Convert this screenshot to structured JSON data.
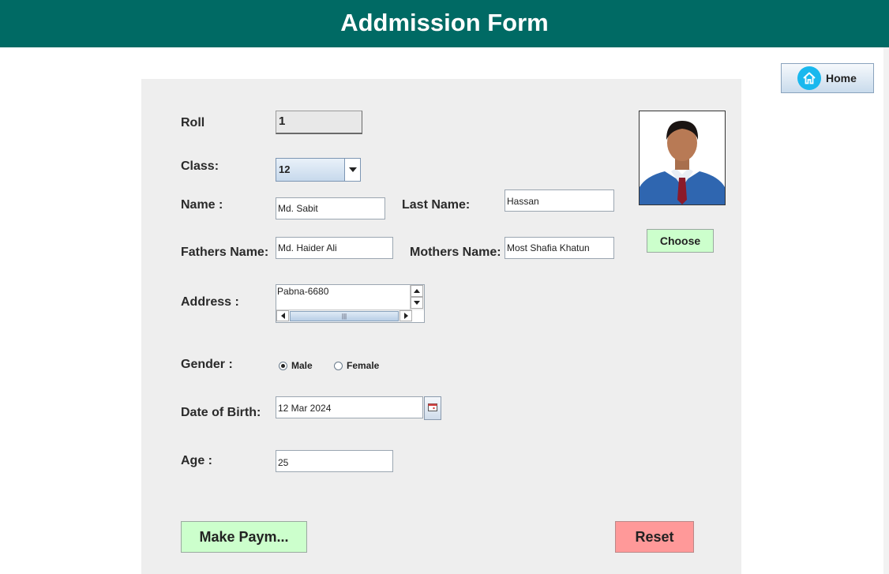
{
  "header": {
    "title": "Addmission Form"
  },
  "home_button": {
    "label": "Home",
    "icon": "home-icon"
  },
  "form": {
    "roll": {
      "label": "Roll",
      "value": "1"
    },
    "class": {
      "label": "Class:",
      "value": "12"
    },
    "name": {
      "label": "Name :",
      "value": "Md. Sabit"
    },
    "last_name": {
      "label": "Last Name:",
      "value": "Hassan"
    },
    "fathers_name": {
      "label": "Fathers Name:",
      "value": "Md. Haider Ali"
    },
    "mothers_name": {
      "label": "Mothers Name:",
      "value": "Most Shafia Khatun"
    },
    "address": {
      "label": "Address :",
      "value": "Pabna-6680"
    },
    "gender": {
      "label": "Gender :",
      "options": [
        "Male",
        "Female"
      ],
      "selected": "Male"
    },
    "dob": {
      "label": "Date of Birth:",
      "value": "12 Mar 2024"
    },
    "age": {
      "label": "Age :",
      "value": "25"
    }
  },
  "photo": {
    "choose_label": "Choose"
  },
  "buttons": {
    "payment": "Make Paym...",
    "reset": "Reset"
  },
  "colors": {
    "header": "#006a64",
    "panel": "#eeeeee",
    "green_button": "#ccffcc",
    "red_button": "#ff9999"
  }
}
